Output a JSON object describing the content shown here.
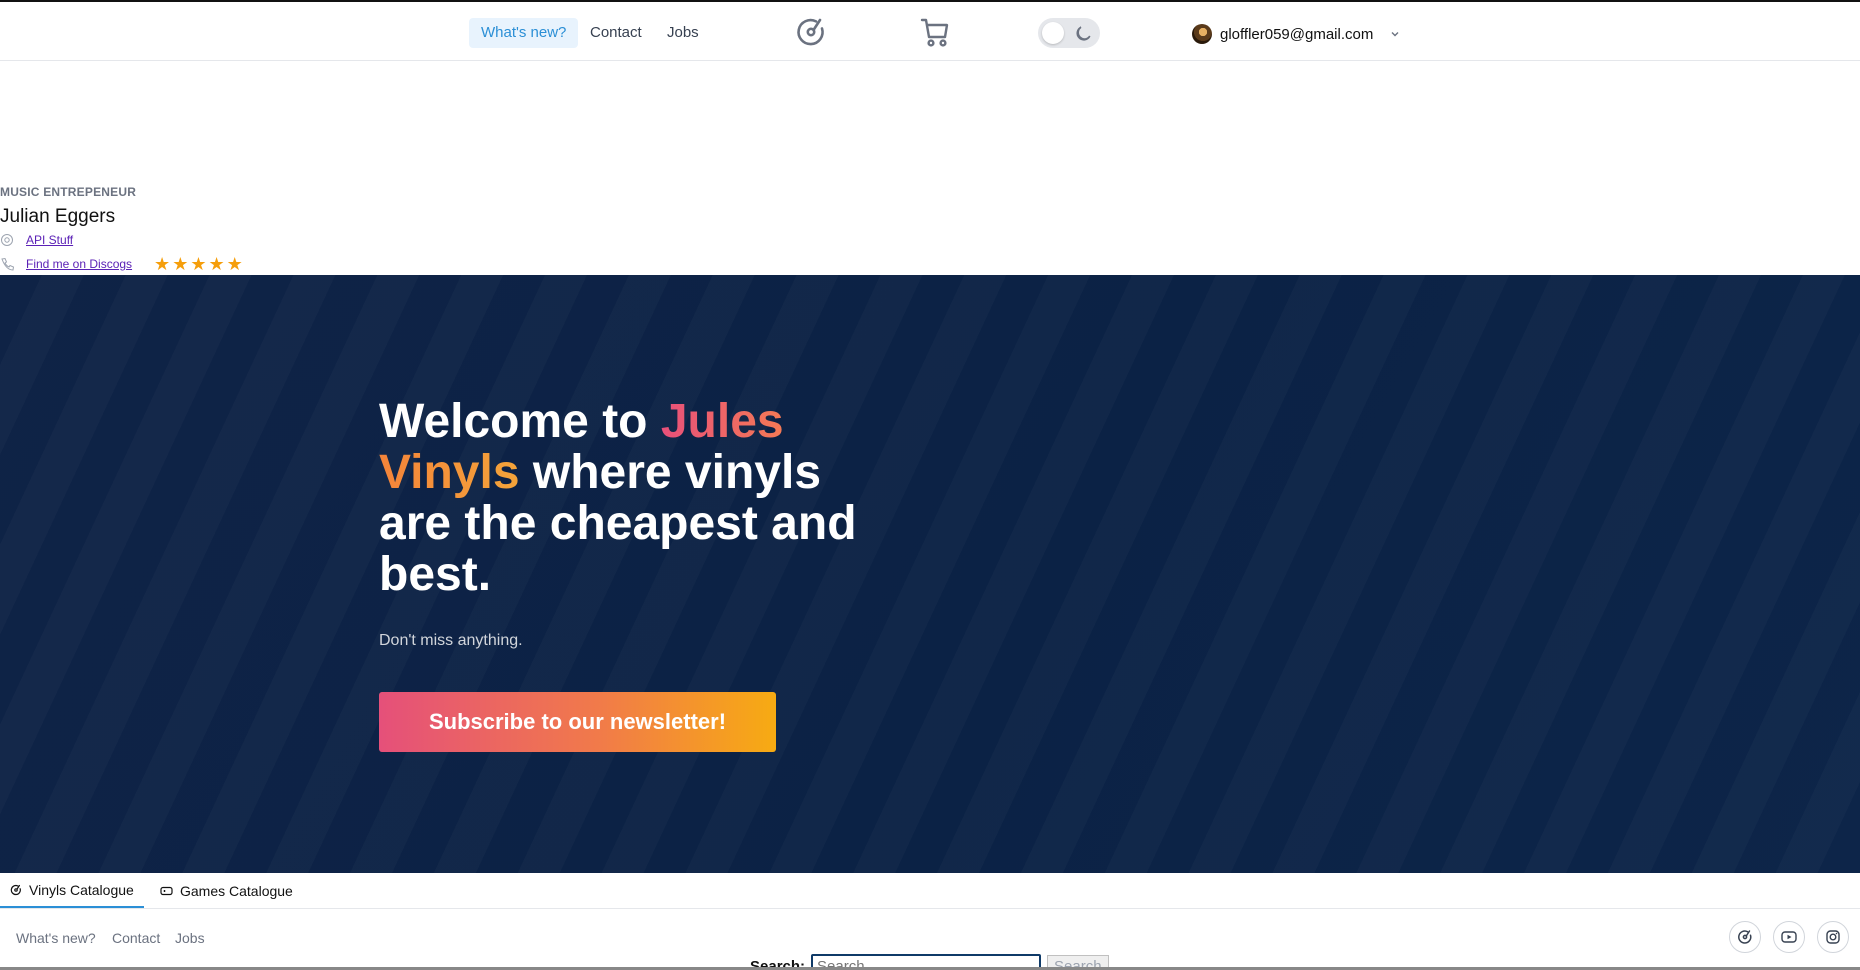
{
  "header": {
    "nav": [
      "What's new?",
      "Contact",
      "Jobs"
    ],
    "user_email": "gloffler059@gmail.com",
    "icons": [
      "vinyl-logo-icon",
      "cart-icon",
      "moon-icon",
      "chevron-down-icon"
    ]
  },
  "profile": {
    "role": "MUSIC ENTREPENEUR",
    "name": "Julian Eggers",
    "link1": "API Stuff",
    "link2": "Find me on Discogs",
    "rating": 5
  },
  "hero": {
    "title_prefix": "Welcome to ",
    "title_brand1": "Jules",
    "title_brand2": "Vinyls",
    "title_suffix": " where vinyls are the cheapest and best.",
    "subtitle": "Don't miss anything.",
    "cta": "Subscribe to our newsletter!",
    "colors": {
      "background": "#0b2245",
      "accent_pink": "#e8507a",
      "accent_orange": "#f7ab12"
    }
  },
  "tabs": [
    "Vinyls Catalogue",
    "Games Catalogue"
  ],
  "footer": {
    "links": [
      "What's new?",
      "Contact",
      "Jobs"
    ],
    "search_label": "Search:",
    "search_placeholder": "Search",
    "search_button": "Search"
  }
}
